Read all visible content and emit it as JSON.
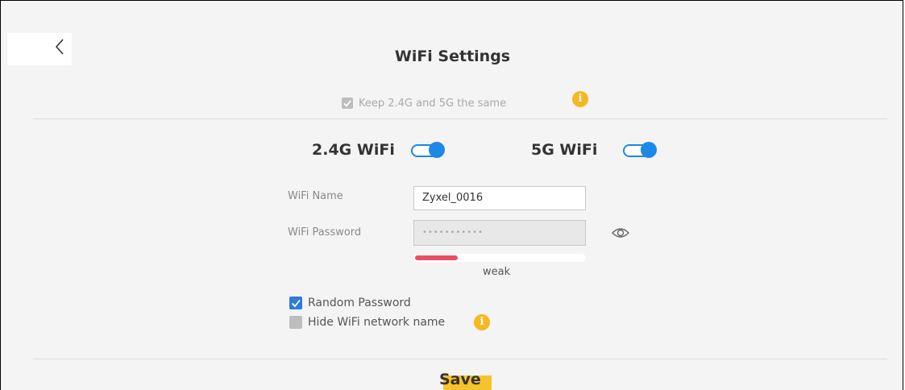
{
  "page": {
    "title": "WiFi Settings",
    "back_icon": "chevron-left-icon"
  },
  "sync": {
    "label": "Keep 2.4G and 5G the same",
    "checked": true,
    "info_icon": "info-icon"
  },
  "bands": {
    "band_24": {
      "label": "2.4G WiFi",
      "enabled": true
    },
    "band_5": {
      "label": "5G WiFi",
      "enabled": true
    }
  },
  "form": {
    "name_label": "WiFi Name",
    "name_value": "Zyxel_0016",
    "password_label": "WiFi Password",
    "password_mask": "•••••••••••",
    "show_password_icon": "eye-icon",
    "strength_label": "weak",
    "strength_level": 0.25
  },
  "options": {
    "random_password": {
      "label": "Random Password",
      "checked": true
    },
    "hide_name": {
      "label": "Hide WiFi network name",
      "checked": false,
      "info_icon": "info-icon"
    }
  },
  "actions": {
    "save_label": "Save"
  },
  "colors": {
    "accent": "#1e88e5",
    "info": "#f6b821",
    "strength_weak": "#e84f62",
    "save_highlight": "#f6c32a"
  }
}
